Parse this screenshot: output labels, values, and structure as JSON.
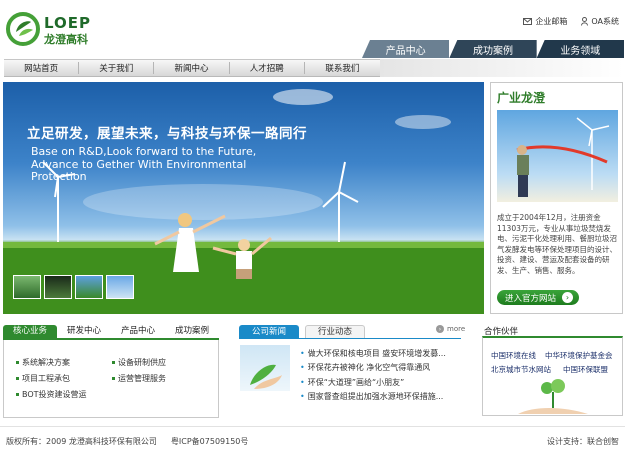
{
  "brand": {
    "en": "LOEP",
    "cn": "龙澄高科"
  },
  "top_links": {
    "mail": "企业邮箱",
    "oa": "OA系统"
  },
  "tabs": [
    "产品中心",
    "成功案例",
    "业务领域"
  ],
  "nav": [
    "网站首页",
    "关于我们",
    "新闻中心",
    "人才招聘",
    "联系我们"
  ],
  "banner": {
    "title": "立足研发，展望未来，与科技与环保一路同行",
    "sub": "Base on R&D,Look forward to the Future, Advance to Gether With Environmental Protection"
  },
  "side": {
    "title": "广业龙澄",
    "text": "成立于2004年12月，注册资金11303万元，专业从事垃圾焚烧发电、污泥干化处理利用、餐厨垃圾沼气发酵发电等环保处理项目的设计、投资、建设、营运及配套设备的研发、生产、销售、服务。",
    "button": "进入官方网站"
  },
  "core": {
    "tabs": [
      "核心业务",
      "研发中心",
      "产品中心",
      "成功案例"
    ],
    "items": [
      "系统解决方案",
      "设备研制供应",
      "项目工程承包",
      "运营管理服务",
      "BOT投资建设营运"
    ]
  },
  "news": {
    "tabs": [
      "公司新闻",
      "行业动态"
    ],
    "more": "more",
    "items": [
      "做大环保和核电项目 盛安环境增发募...",
      "环保花卉被神化 净化空气得靠通风",
      "环保“大道理”画给“小朋友”",
      "国家督查组提出加强水源地环保措施..."
    ]
  },
  "partners": {
    "title": "合作伙伴",
    "items": [
      "中国环境在线",
      "中华环境保护基金会",
      "北京城市节水网站",
      "中国环保联盟"
    ]
  },
  "footer": {
    "copyright": "版权所有：2009 龙澄高科技环保有限公司",
    "icp": "粤ICP备07509150号",
    "design": "设计支持：联合创智"
  }
}
